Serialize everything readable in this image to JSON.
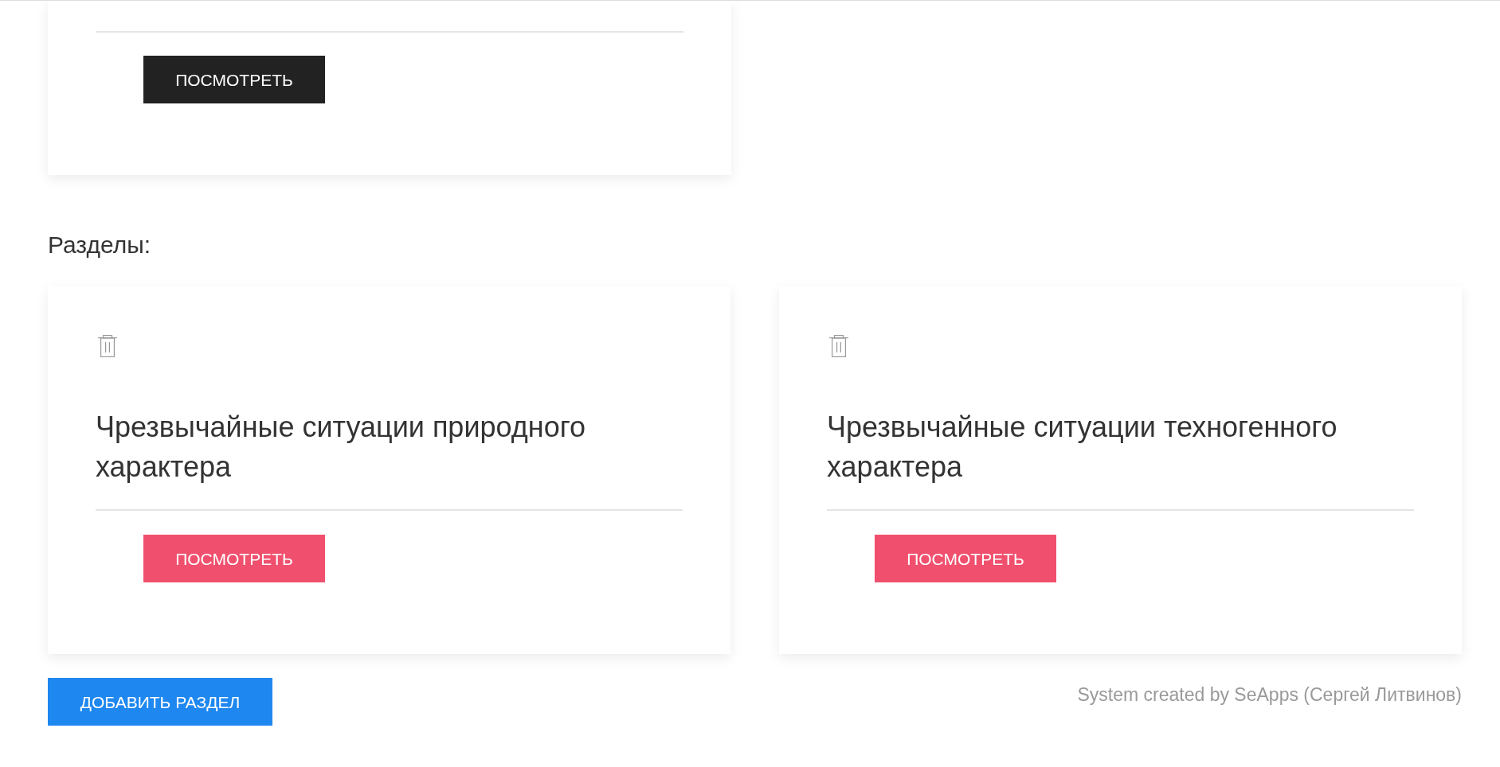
{
  "top_card": {
    "button": {
      "label": "ПОСМОТРЕТЬ",
      "kind": "dark"
    }
  },
  "sections": {
    "heading": "Разделы:",
    "cards": [
      {
        "title": "Чрезвычайные ситуации природного характера",
        "button": {
          "label": "ПОСМОТРЕТЬ",
          "kind": "danger"
        }
      },
      {
        "title": "Чрезвычайные ситуации техногенного характера",
        "button": {
          "label": "ПОСМОТРЕТЬ",
          "kind": "danger"
        }
      }
    ]
  },
  "add_button": {
    "label": "ДОБАВИТЬ РАЗДЕЛ",
    "kind": "primary"
  },
  "footer": {
    "credit": "System created by SeApps (Сергей Литвинов)"
  }
}
